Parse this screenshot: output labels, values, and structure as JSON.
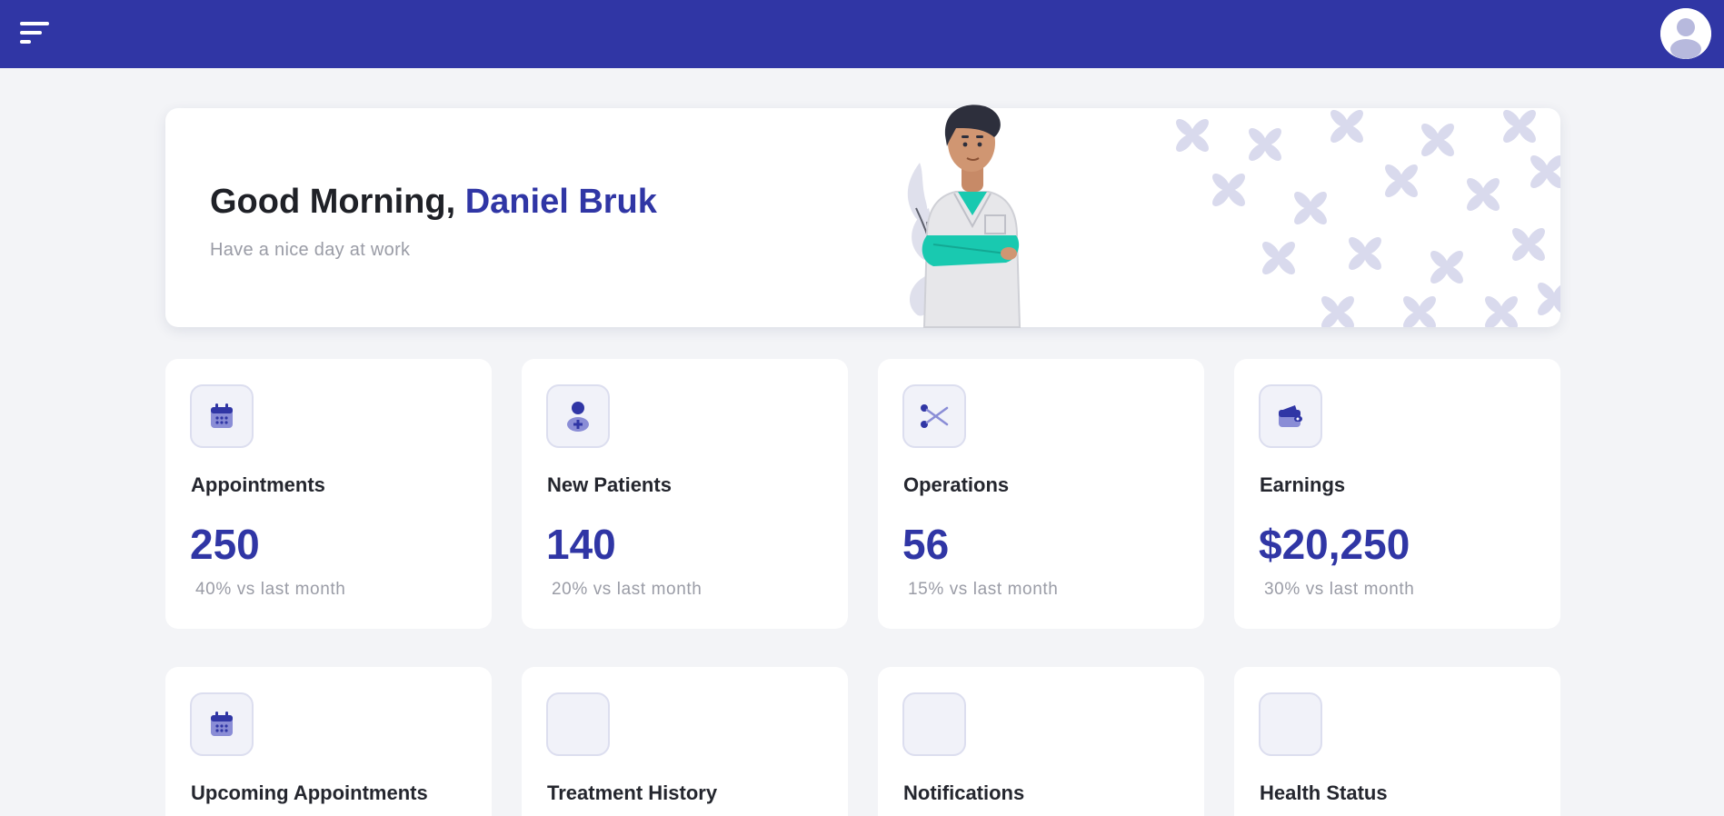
{
  "header": {
    "menu_icon": "menu-icon",
    "avatar_icon": "user-avatar-icon",
    "bar_color": "#3036a5"
  },
  "welcome": {
    "greeting": "Good Morning,",
    "name": "Daniel Bruk",
    "subtitle": "Have a nice day at work",
    "accent_color": "#3036a5"
  },
  "stats": [
    {
      "label": "Appointments",
      "value": "250",
      "trend": "40% vs last month",
      "icon": "calendar-icon"
    },
    {
      "label": "New Patients",
      "value": "140",
      "trend": "20% vs last month",
      "icon": "patient-icon"
    },
    {
      "label": "Operations",
      "value": "56",
      "trend": "15% vs last month",
      "icon": "scissors-icon"
    },
    {
      "label": "Earnings",
      "value": "$20,250",
      "trend": "30% vs last month",
      "icon": "wallet-icon"
    }
  ],
  "features": [
    {
      "label": "Upcoming Appointments",
      "icon": "calendar-icon"
    },
    {
      "label": "Treatment History",
      "icon": ""
    },
    {
      "label": "Notifications",
      "icon": ""
    },
    {
      "label": "Health Status",
      "icon": ""
    }
  ]
}
